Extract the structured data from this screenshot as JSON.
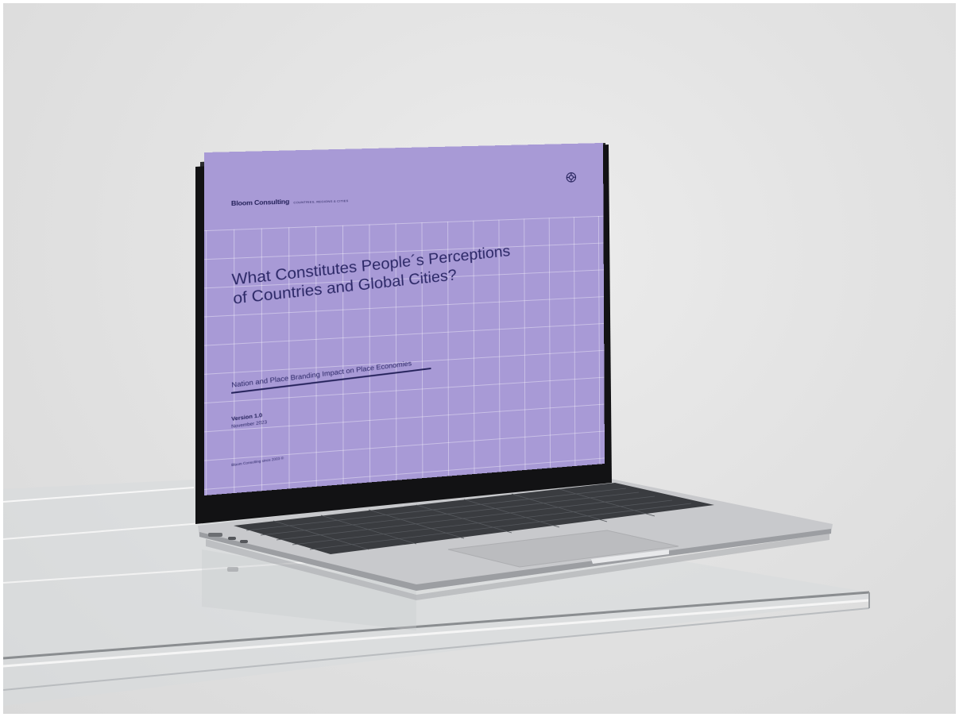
{
  "slide": {
    "brand_name": "Bloom Consulting",
    "brand_tagline": "COUNTRIES, REGIONS & CITIES",
    "title": "What Constitutes People´s Perceptions\nof Countries and Global Cities?",
    "subtitle": "Nation and Place Branding Impact on Place Economies",
    "version": "Version 1.0",
    "date": "November 2023",
    "footer": "Bloom Consulting since 2003 ©"
  },
  "icons": {
    "logo": "target-crosshair-icon"
  },
  "colors": {
    "screen_background": "#a89ad6",
    "text": "#2b2766",
    "laptop_body": "#c8c9cc",
    "bezel": "#121214",
    "backdrop": "#e3e3e3"
  }
}
